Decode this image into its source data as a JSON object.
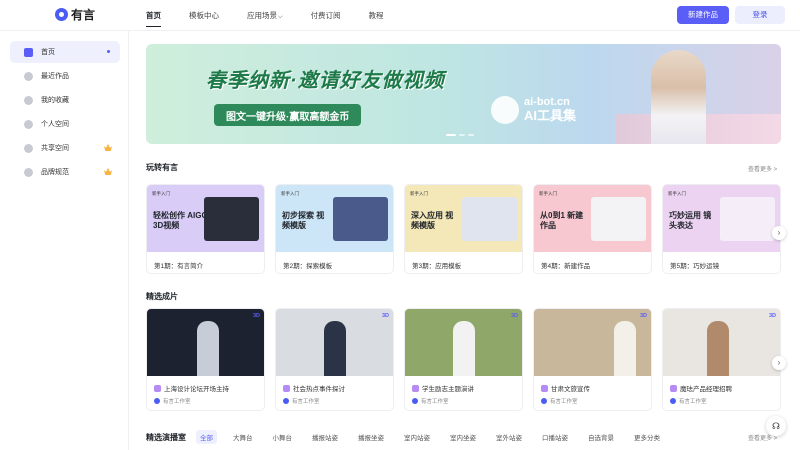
{
  "brand": {
    "name": "有言"
  },
  "nav": [
    "首页",
    "模板中心",
    "应用场景",
    "付费订阅",
    "教程"
  ],
  "header": {
    "new_work": "新建作品",
    "login": "登录"
  },
  "sidebar": {
    "items": [
      {
        "label": "首页",
        "icon": "home-icon"
      },
      {
        "label": "最近作品",
        "icon": "clock-icon"
      },
      {
        "label": "我的收藏",
        "icon": "star-icon"
      },
      {
        "label": "个人空间",
        "icon": "user-icon"
      },
      {
        "label": "共享空间",
        "icon": "grid-icon",
        "vip": true
      },
      {
        "label": "品牌规范",
        "icon": "crown-icon",
        "vip": true
      }
    ]
  },
  "banner": {
    "title": "春季纳新·邀请好友做视频",
    "subtitle": "图文一键升级·赢取高额金币",
    "brand_url": "ai-bot.cn",
    "brand_name": "AI工具集"
  },
  "section_play": {
    "title": "玩转有言",
    "see_more": "查看更多 >",
    "cards": [
      {
        "tag": "新手入门",
        "headline": "轻松创作 AIGC 3D视频",
        "caption": "第1期：有言简介",
        "bg": "#d9ccf7"
      },
      {
        "tag": "新手入门",
        "headline": "初步探索 视频模版",
        "caption": "第2期：探索模板",
        "bg": "#cce6f7"
      },
      {
        "tag": "新手入门",
        "headline": "深入应用 视频模版",
        "caption": "第3期：应用模板",
        "bg": "#f5e8b8"
      },
      {
        "tag": "新手入门",
        "headline": "从0到1 新建作品",
        "caption": "第4期：新建作品",
        "bg": "#f7c8d0"
      },
      {
        "tag": "新手入门",
        "headline": "巧妙运用 镜头表达",
        "caption": "第5期：巧妙运镜",
        "bg": "#ecd3f2"
      }
    ]
  },
  "section_works": {
    "title": "精选成片",
    "badge": "3D",
    "author": "有言工作室",
    "items": [
      {
        "title": "上海设计论坛开场主持",
        "bg": "#1c2230"
      },
      {
        "title": "社会热点事件探讨",
        "bg": "#d9dde2"
      },
      {
        "title": "学生励志主题演讲",
        "bg": "#8fa86a"
      },
      {
        "title": "甘肃文旅宣传",
        "bg": "#c9b79b"
      },
      {
        "title": "魔珐产品经理招聘",
        "bg": "#e9e6e2"
      }
    ]
  },
  "section_hosts": {
    "title": "精选演播室",
    "chips": [
      "全部",
      "大舞台",
      "小舞台",
      "播报站姿",
      "播报坐姿",
      "室内站姿",
      "室内坐姿",
      "室外站姿",
      "口播站姿",
      "自选背景",
      "更多分类"
    ],
    "see_more": "查看更多 >"
  }
}
